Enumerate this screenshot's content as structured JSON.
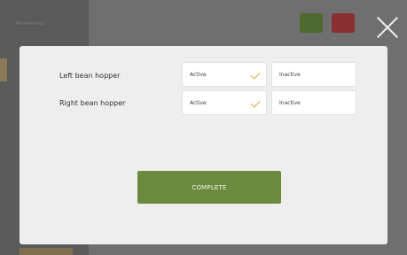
{
  "background": {
    "sidebar_title": "Maintenance",
    "icons": [
      "gear-icon",
      "warning-icon"
    ]
  },
  "modal": {
    "rows": [
      {
        "label": "Left bean hopper",
        "options": [
          "Active",
          "Inactive"
        ],
        "selected": "Active"
      },
      {
        "label": "Right bean hopper",
        "options": [
          "Active",
          "Inactive"
        ],
        "selected": "Active"
      }
    ],
    "complete_label": "COMPLETE"
  },
  "colors": {
    "accent_green": "#6b8a3c",
    "check_orange": "#e0a53b",
    "overlay": "#6f6f6f"
  }
}
